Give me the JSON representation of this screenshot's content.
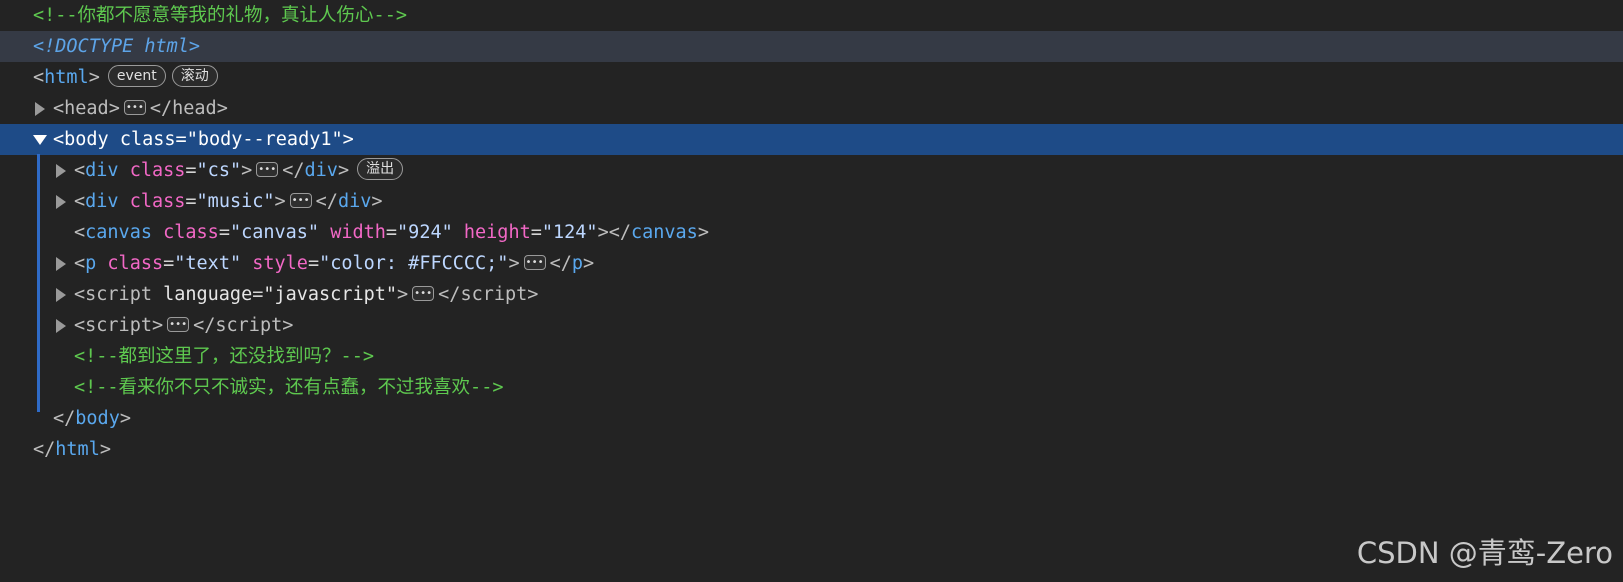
{
  "panel": {
    "comment_top": "<!--你都不愿意等我的礼物，真让人伤心-->",
    "doctype": "<!DOCTYPE html>",
    "html_tag": "html",
    "html_badges": [
      "event",
      "滚动"
    ],
    "head_tag": "head",
    "body": {
      "tag": "body",
      "class_attr": "class",
      "class_val": "\"body--ready1\""
    },
    "div_cs": {
      "tag": "div",
      "attr": "class",
      "val": "\"cs\"",
      "close": "div",
      "badge": "溢出"
    },
    "div_music": {
      "tag": "div",
      "attr": "class",
      "val": "\"music\"",
      "close": "div"
    },
    "canvas": {
      "tag": "canvas",
      "attrs": [
        {
          "name": "class",
          "value": "\"canvas\""
        },
        {
          "name": "width",
          "value": "\"924\""
        },
        {
          "name": "height",
          "value": "\"124\""
        }
      ],
      "close": "canvas"
    },
    "p_text": {
      "tag": "p",
      "attrs": [
        {
          "name": "class",
          "value": "\"text\""
        },
        {
          "name": "style",
          "value": "\"color: #FFCCCC;\""
        }
      ],
      "close": "p"
    },
    "script1": {
      "tag": "script",
      "attr": "language",
      "val": "\"javascript\"",
      "close": "script"
    },
    "script2": {
      "tag": "script",
      "close": "script"
    },
    "comment_a": "<!--都到这里了，还没找到吗？-->",
    "comment_b": "<!--看来你不只不诚实，还有点蠢，不过我喜欢-->",
    "body_close": "body",
    "html_close": "html"
  },
  "watermark": "CSDN @青鸾-Zero",
  "colors": {
    "background": "#232323",
    "selected_row": "#1e4b87",
    "hover_row": "#353a45",
    "comment": "#5ec84f",
    "tag": "#5aa8ee",
    "attr": "#f268c6"
  }
}
